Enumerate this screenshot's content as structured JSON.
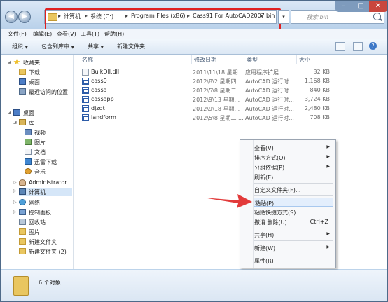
{
  "address": {
    "segments": [
      "计算机",
      "系统 (C:)",
      "Program Files (x86)",
      "Cass91 For AutoCAD2007",
      "bin"
    ]
  },
  "search": {
    "placeholder": "搜索 bin"
  },
  "menubar": {
    "items": [
      "文件(F)",
      "编辑(E)",
      "查看(V)",
      "工具(T)",
      "帮助(H)"
    ]
  },
  "toolbar": {
    "organize": "组织",
    "include_library": "包含到库中",
    "share": "共享",
    "new_folder": "新建文件夹"
  },
  "sidebar": {
    "favorites": "收藏夹",
    "downloads": "下载",
    "desktop_fav": "桌面",
    "recent": "最近访问的位置",
    "desktop": "桌面",
    "library": "库",
    "videos": "视频",
    "pictures": "图片",
    "documents": "文档",
    "thunder": "迅雷下载",
    "music": "音乐",
    "admin": "Administrator",
    "computer": "计算机",
    "network": "网络",
    "control_panel": "控制面板",
    "recycle_bin": "回收站",
    "pictures2": "图片",
    "new_folder": "新建文件夹",
    "new_folder2": "新建文件夹 (2)"
  },
  "columns": {
    "name": "名称",
    "date": "修改日期",
    "type": "类型",
    "size": "大小"
  },
  "files": [
    {
      "name": "BulkDll.dll",
      "date": "2011\\11\\18 星期...",
      "type": "应用程序扩展",
      "size": "32 KB",
      "icon": "dll-icon"
    },
    {
      "name": "cass9",
      "date": "2012\\8\\2 星期四 ...",
      "type": "AutoCAD 运行时...",
      "size": "1,168 KB",
      "icon": "autocad-file-icon"
    },
    {
      "name": "cassa",
      "date": "2012\\5\\8 星期二 ...",
      "type": "AutoCAD 运行时...",
      "size": "840 KB",
      "icon": "autocad-file-icon"
    },
    {
      "name": "cassapp",
      "date": "2012\\9\\13 星期...",
      "type": "AutoCAD 运行时...",
      "size": "3,724 KB",
      "icon": "autocad-file-icon"
    },
    {
      "name": "djzdt",
      "date": "2012\\9\\18 星期...",
      "type": "AutoCAD 运行时...",
      "size": "2,480 KB",
      "icon": "autocad-file-icon"
    },
    {
      "name": "landform",
      "date": "2012\\5\\8 星期二 ...",
      "type": "AutoCAD 运行时...",
      "size": "708 KB",
      "icon": "autocad-file-icon"
    }
  ],
  "context_menu": {
    "view": "查看(V)",
    "sort": "排序方式(O)",
    "group": "分组依据(P)",
    "refresh": "刷新(E)",
    "customize": "自定义文件夹(F)...",
    "paste": "粘贴(P)",
    "paste_shortcut": "粘贴快捷方式(S)",
    "undo_delete": "撤消 删除(U)",
    "undo_shortcut": "Ctrl+Z",
    "share": "共享(H)",
    "new": "新建(W)",
    "properties": "属性(R)"
  },
  "status": {
    "count": "6 个对象"
  },
  "colors": {
    "highlight_box": "#e02020",
    "arrow": "#e23a3a"
  }
}
